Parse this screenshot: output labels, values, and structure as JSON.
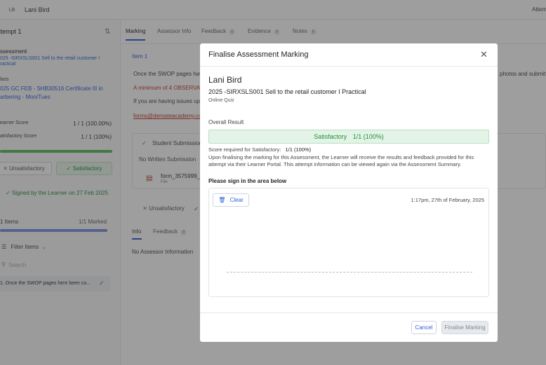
{
  "topbar": {
    "avatar": "LB",
    "name": "Lani Bird",
    "right": "Attem"
  },
  "left": {
    "attempt_title": "ttempt 1",
    "assessment_label": "ssessment",
    "assessment_line1": "025 -SIRXSLS001 Sell to the retail customer I",
    "assessment_line2": "ractical",
    "class_label": "lass",
    "class_line1": "025 GC FEB - SHB30516 Certificate III in",
    "class_line2": "arbering - Mon/Tues",
    "learner_score_label": "earner Score",
    "learner_score_value": "1 / 1 (100.00%)",
    "satisfactory_label": "atisfactory Score",
    "satisfactory_value": "1 / 1 (100%)",
    "score_progress": 1.0,
    "unsatisfactory_button": "Unsatisfactory",
    "satisfactory_button": "Satisfactory",
    "signed_text": "Signed by the Learner on 27 Feb 2025",
    "items_label": "1 Items",
    "marked_label": "1/1 Marked",
    "marked_progress": 1.0,
    "filter_label": "Filter Items",
    "search_placeholder": "Search",
    "item_text": "1. Once the SWOP pages here been co..."
  },
  "main": {
    "tabs": [
      {
        "label": "Marking"
      },
      {
        "label": "Assessor Info"
      },
      {
        "label": "Feedback",
        "count": "0"
      },
      {
        "label": "Evidence",
        "count": "0"
      },
      {
        "label": "Notes",
        "count": "0"
      }
    ],
    "item_heading": "Item 1",
    "instr_1": "Once the SWOP pages have b",
    "instr_1_right": "photos and submit a",
    "instr_2": "A minimum of 4 OBSERVATI",
    "instr_3": "If you are having issues uploa",
    "email": "forms@demateacademy.com",
    "student_submission": "Student Submission",
    "no_written": "No Written Submission",
    "file_name": "form_3575999_",
    "file_sub": "File",
    "unsatisfactory_small": "Unsatisfactory",
    "info_tab": "Info",
    "feedback_tab": "Feedback",
    "feedback_count": "0",
    "no_assessor": "No Assessor Information"
  },
  "modal": {
    "title": "Finalise Assessment Marking",
    "learner_name": "Lani Bird",
    "assessment_name": "2025 -SIRXSLS001 Sell to the retail customer I Practical",
    "assessment_type": "Online Quiz",
    "overall_result_label": "Overall Result",
    "result_text": "Satisfactory",
    "result_score": "1/1 (100%)",
    "score_required_prefix": "Score required for Satisfactory:",
    "score_required_value": "1/1 (100%)",
    "notice_line1": "Upon finalising the marking for this Assessment, the Learner will receive the results and feedback provided for this",
    "notice_line2": "attempt via their Learner Portal. This attempt information can be viewed again via the Assessment Summary.",
    "sign_prompt": "Please sign in the area below",
    "clear_button": "Clear",
    "timestamp": "1:17pm, 27th of February, 2025",
    "cancel_button": "Cancel",
    "finalise_button": "Finalise Marking",
    "success_color": "#1f8f3a",
    "accent_color": "#2c5fd6"
  }
}
